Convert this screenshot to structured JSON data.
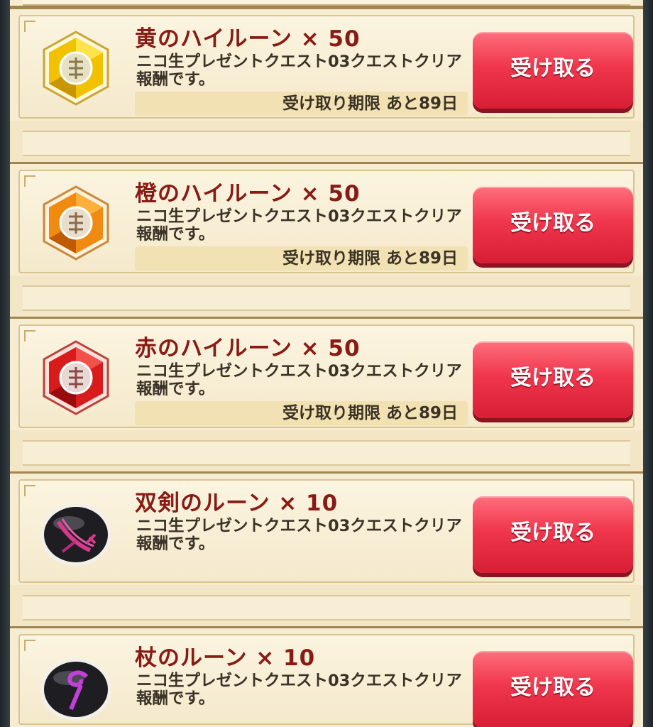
{
  "colors": {
    "title": "#8a1a14",
    "button": "#f0364c",
    "card": "#f6ecd2"
  },
  "rewards": [
    {
      "title": "黄のハイルーン × 50",
      "desc": "ニコ生プレゼントクエスト03クエストクリア報酬です。",
      "deadline": "受け取り期限 あと89日",
      "button": "受け取る",
      "icon": "yellow-high-rune-icon"
    },
    {
      "title": "橙のハイルーン × 50",
      "desc": "ニコ生プレゼントクエスト03クエストクリア報酬です。",
      "deadline": "受け取り期限 あと89日",
      "button": "受け取る",
      "icon": "orange-high-rune-icon"
    },
    {
      "title": "赤のハイルーン × 50",
      "desc": "ニコ生プレゼントクエスト03クエストクリア報酬です。",
      "deadline": "受け取り期限 あと89日",
      "button": "受け取る",
      "icon": "red-high-rune-icon"
    },
    {
      "title": "双剣のルーン × 10",
      "desc": "ニコ生プレゼントクエスト03クエストクリア報酬です。",
      "button": "受け取る",
      "icon": "twin-sword-rune-icon"
    },
    {
      "title": "杖のルーン × 10",
      "desc": "ニコ生プレゼントクエスト03クエストクリア報酬です。",
      "button": "受け取る",
      "icon": "staff-rune-icon"
    }
  ]
}
